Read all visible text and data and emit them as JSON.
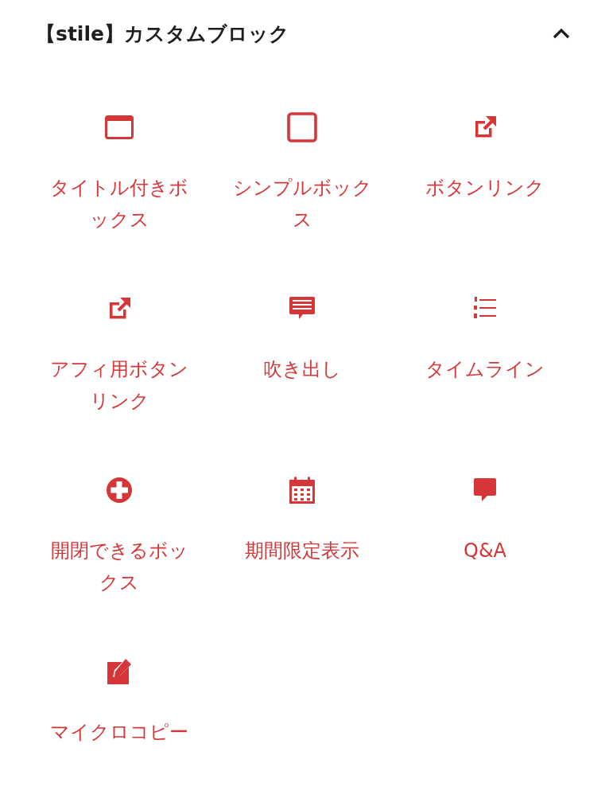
{
  "panel": {
    "title": "【stile】カスタムブロック",
    "expanded": true
  },
  "blocks": [
    {
      "label": "タイトル付きボックス",
      "kind": "titlebox"
    },
    {
      "label": "シンプルボックス",
      "kind": "box"
    },
    {
      "label": "ボタンリンク",
      "kind": "external"
    },
    {
      "label": "アフィ用ボタンリンク",
      "kind": "external"
    },
    {
      "label": "吹き出し",
      "kind": "comment"
    },
    {
      "label": "タイムライン",
      "kind": "numlist"
    },
    {
      "label": "開閉できるボックス",
      "kind": "plus"
    },
    {
      "label": "期間限定表示",
      "kind": "calendar"
    },
    {
      "label": "Q&A",
      "kind": "speech"
    },
    {
      "label": "マイクロコピー",
      "kind": "edit"
    }
  ]
}
